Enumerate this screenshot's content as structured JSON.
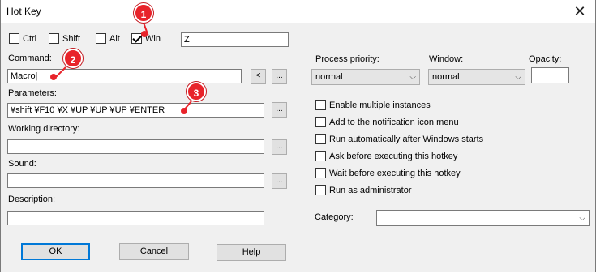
{
  "window": {
    "title": "Hot Key"
  },
  "modifiers": [
    {
      "label": "Ctrl",
      "checked": false
    },
    {
      "label": "Shift",
      "checked": false
    },
    {
      "label": "Alt",
      "checked": false
    },
    {
      "label": "Win",
      "checked": true
    }
  ],
  "key_value": "Z",
  "command": {
    "label": "Command:",
    "value": "Macro|",
    "back_button": "<",
    "browse_button": "..."
  },
  "parameters": {
    "label": "Parameters:",
    "value": "¥shift ¥F10 ¥X ¥UP ¥UP ¥UP ¥ENTER",
    "browse_button": "..."
  },
  "working_directory": {
    "label": "Working directory:",
    "value": "",
    "browse_button": "..."
  },
  "sound": {
    "label": "Sound:",
    "value": "",
    "browse_button": "..."
  },
  "description": {
    "label": "Description:",
    "value": ""
  },
  "process_priority": {
    "label": "Process priority:",
    "value": "normal"
  },
  "window_mode": {
    "label": "Window:",
    "value": "normal"
  },
  "opacity": {
    "label": "Opacity:",
    "value": ""
  },
  "options": [
    {
      "label": "Enable multiple instances",
      "checked": false
    },
    {
      "label": "Add to the notification icon menu",
      "checked": false
    },
    {
      "label": "Run automatically after Windows starts",
      "checked": false
    },
    {
      "label": "Ask before executing this hotkey",
      "checked": false
    },
    {
      "label": "Wait before executing this hotkey",
      "checked": false
    },
    {
      "label": "Run as administrator",
      "checked": false
    }
  ],
  "category": {
    "label": "Category:",
    "value": ""
  },
  "buttons": {
    "ok": "OK",
    "cancel": "Cancel",
    "help": "Help"
  },
  "markers": [
    "1",
    "2",
    "3"
  ],
  "icons": {
    "close": "close-icon",
    "dropdown": "chevron-down-icon"
  },
  "colors": {
    "marker": "#e8232a",
    "dialog_bg": "#f0f0f0",
    "focus": "#0078d7"
  }
}
